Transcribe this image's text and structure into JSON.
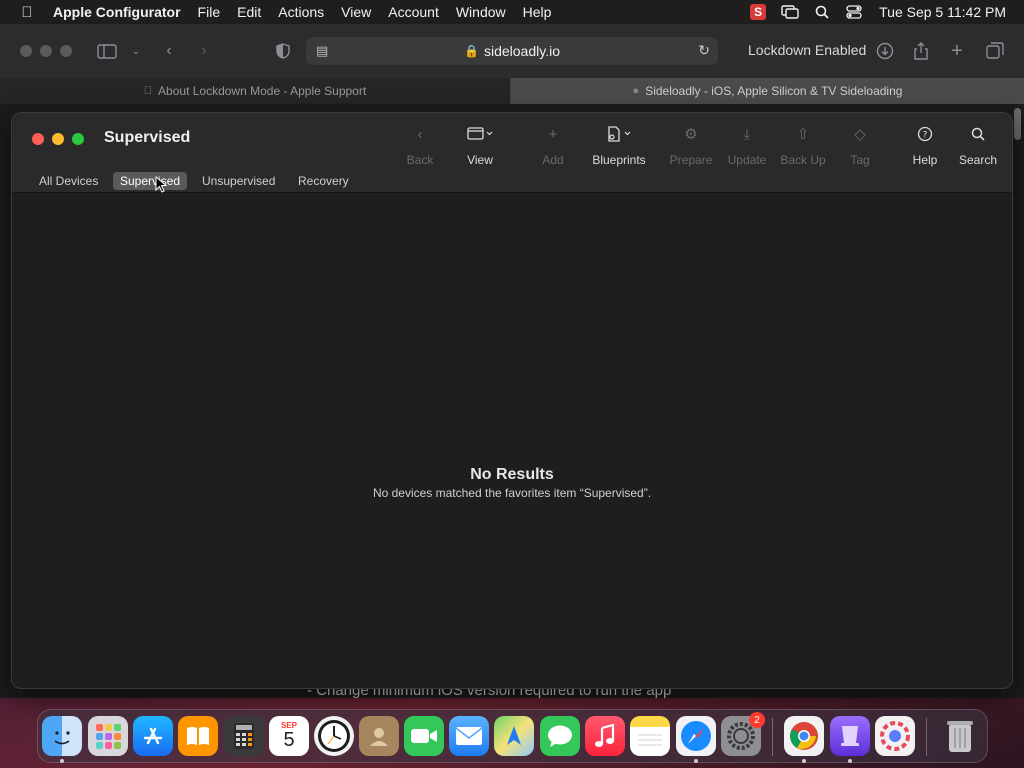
{
  "menubar": {
    "app_name": "Apple Configurator",
    "items": [
      "File",
      "Edit",
      "Actions",
      "View",
      "Account",
      "Window",
      "Help"
    ],
    "clock": "Tue Sep 5  11:42 PM"
  },
  "safari": {
    "address": "sideloadly.io",
    "lockdown": "Lockdown Enabled",
    "tabs": [
      {
        "label": "About Lockdown Mode - Apple Support"
      },
      {
        "label": "Sideloadly - iOS, Apple Silicon & TV Sideloading"
      }
    ],
    "peek_text": "- Change minimum iOS version required to run the app"
  },
  "window": {
    "title": "Supervised",
    "toolbar": {
      "back": "Back",
      "view": "View",
      "add": "Add",
      "blueprints": "Blueprints",
      "prepare": "Prepare",
      "update": "Update",
      "backup": "Back Up",
      "tag": "Tag",
      "help": "Help",
      "search": "Search"
    },
    "scopes": [
      "All Devices",
      "Supervised",
      "Unsupervised",
      "Recovery"
    ],
    "active_scope": "Supervised",
    "empty": {
      "title": "No Results",
      "message": "No devices matched the favorites item “Supervised”."
    }
  },
  "dock": {
    "calendar_month": "SEP",
    "calendar_day": "5",
    "settings_badge": "2",
    "apps": [
      "Finder",
      "Launchpad",
      "App Store",
      "Books",
      "Calculator",
      "Calendar",
      "Clock",
      "Contacts",
      "FaceTime",
      "Mail",
      "Maps",
      "Messages",
      "Music",
      "Notes",
      "Safari",
      "System Settings",
      "Chrome",
      "Apple Configurator",
      "Sideloadly",
      "Trash"
    ]
  },
  "colors": {
    "close": "#ff5f57",
    "minimize": "#febc2e",
    "zoom": "#28c840",
    "active_scope_bg": "#5a5a5c"
  }
}
